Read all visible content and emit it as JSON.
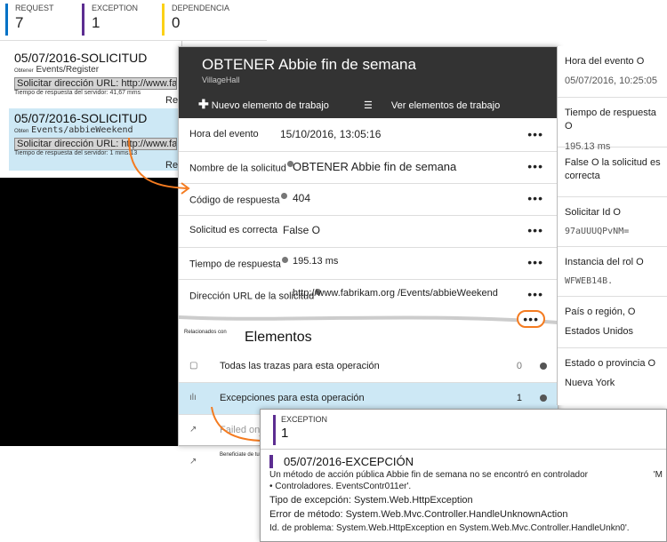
{
  "counts": [
    {
      "label": "REQUEST",
      "value": "7"
    },
    {
      "label": "EXCEPTION",
      "value": "1"
    },
    {
      "label": "DEPENDENCIA",
      "value": "0"
    }
  ],
  "requests": [
    {
      "title": "05/07/2016-SOLICITUD",
      "method": "Obtener",
      "path": "Events/Register",
      "url": "Solicitar dirección URL: http://www.fabrikam",
      "time": "Tiempo de respuesta del servidor: 41,67 mms",
      "extra": ""
    },
    {
      "title": "05/07/2016-SOLICITUD",
      "method": "Obten",
      "path": "Events/abbieWeekend",
      "url": "Solicitar dirección URL: http://www.fabrik?m.",
      "time": "Tiempo de respuesta del servidor: 1 mms.13",
      "extra": "Re"
    }
  ],
  "first_extra": "Re",
  "main": {
    "title": "OBTENER Abbie fin de semana",
    "subtitle": "VillageHall",
    "new_item": "Nuevo elemento de trabajo",
    "view_items": "Ver elementos de trabajo",
    "properties": [
      {
        "key": "Hora del evento",
        "value": "15/10/2016, 13:05:16"
      },
      {
        "key": "Nombre de la solicitud",
        "value": "OBTENER Abbie fin de semana"
      },
      {
        "key": "Código de respuesta",
        "value": "404"
      },
      {
        "key": "Solicitud es correcta",
        "value": "False O"
      },
      {
        "key": "Tiempo de respuesta",
        "value": "195.13 ms"
      },
      {
        "key": "Dirección URL de la solicitud",
        "value": "http://www.fabrikam.org /Events/abbieWeekend"
      }
    ],
    "related_label": "Relacionados con",
    "elements_title": "Elementos",
    "related": [
      {
        "label": "Todas las trazas para esta operación",
        "count": "0"
      },
      {
        "label": "Excepciones para esta operación",
        "count": "1"
      },
      {
        "label": "Failed on",
        "count": ""
      },
      {
        "label": "Beneficiate de tutta te",
        "count": ""
      }
    ]
  },
  "right": [
    {
      "key": "Hora del evento O",
      "value": "05/07/2016, 10:25:05"
    },
    {
      "key": "Tiempo de respuesta O",
      "value": "195.13 ms"
    },
    {
      "key": "False O la solicitud es correcta",
      "value": ""
    },
    {
      "key": "Solicitar Id O",
      "value": "97aUUUQPvNM="
    },
    {
      "key": "Instancia del rol O",
      "value": "WFWEB14B."
    },
    {
      "key": "País o región, O",
      "value": "Estados Unidos"
    },
    {
      "key": "Estado o provincia O",
      "value": "Nueva York"
    }
  ],
  "exception": {
    "label": "EXCEPTION",
    "count": "1",
    "title": "05/07/2016-EXCEPCIÓN",
    "msg1": "Un método de acción pública Abbie fin de semana no se encontró en controlador",
    "msg1_tail": "'M",
    "msg2": "Controladores. EventsContr011er'.",
    "type": "Tipo de excepción: System.Web.HttpException",
    "method": "Error de método: System.Web.Mvc.Controller.HandleUnknownAction",
    "problem": "Id. de problema: System.Web.HttpException en System.Web.Mvc.Controller.HandleUnkn0'."
  },
  "colors": {
    "accent_orange": "#f47b20",
    "exception_purple": "#5c2d91",
    "request_blue": "#0072c6",
    "dependency_yellow": "#fcd116"
  }
}
